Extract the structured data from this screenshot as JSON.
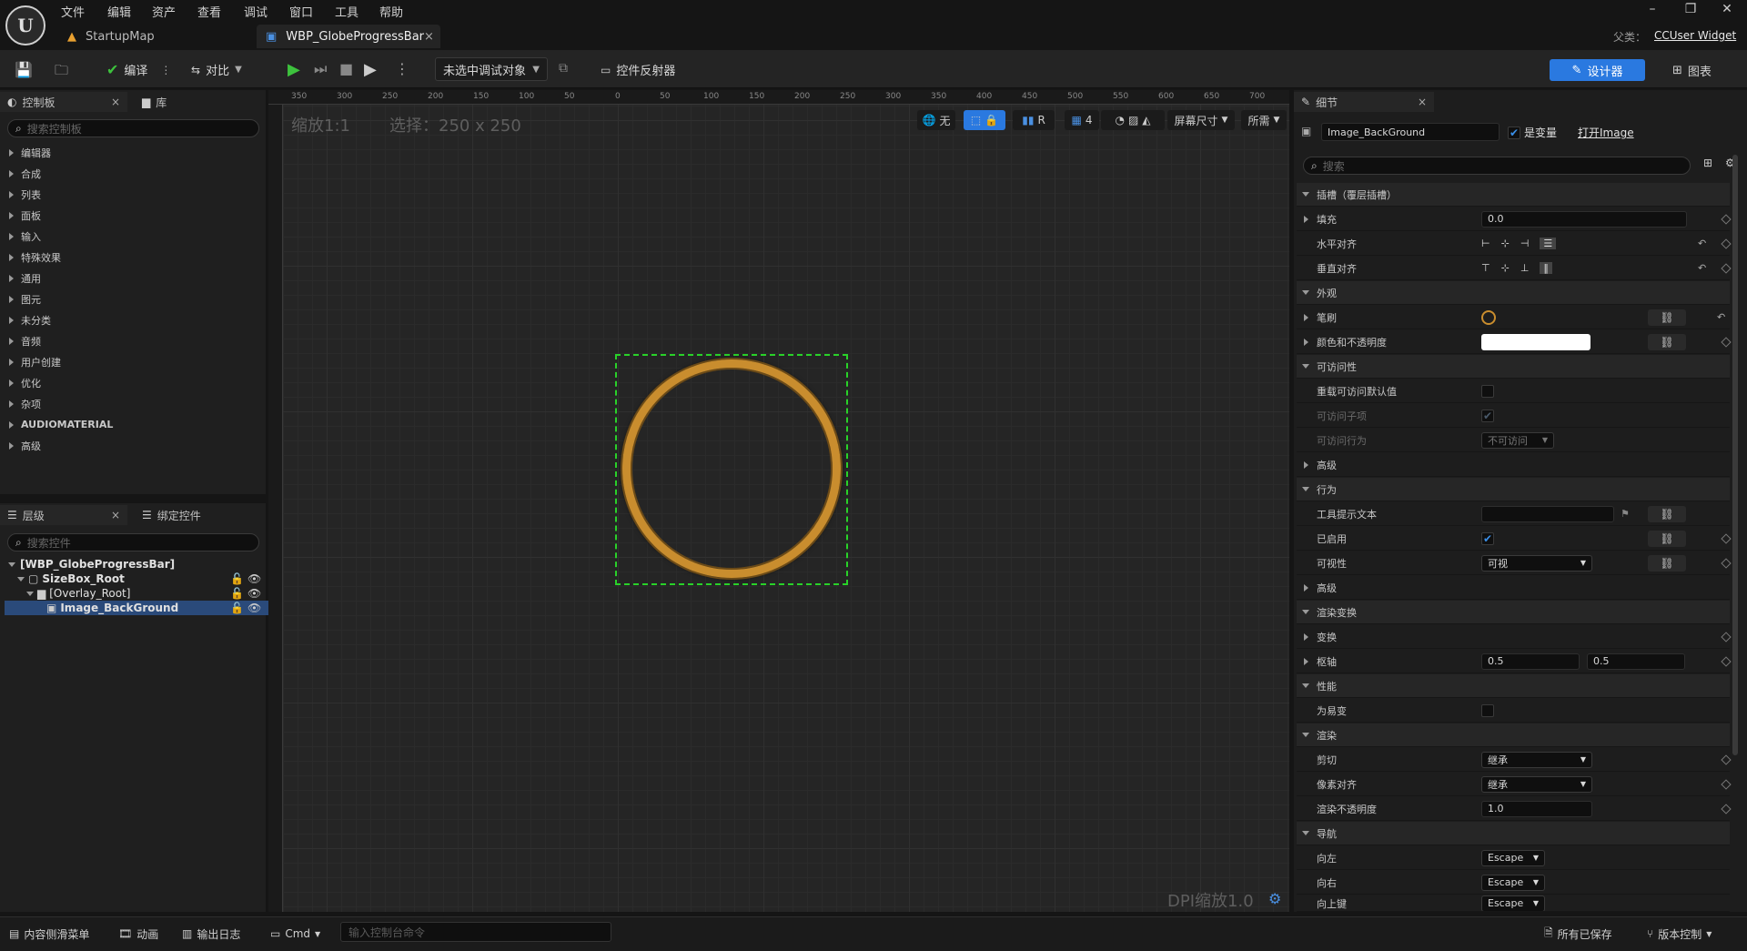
{
  "menu": [
    "文件",
    "编辑",
    "资产",
    "查看",
    "调试",
    "窗口",
    "工具",
    "帮助"
  ],
  "tabs": {
    "map": "StartupMap",
    "widget": "WBP_GlobeProgressBar"
  },
  "parent_class": {
    "label": "父类：",
    "value": "CCUser Widget"
  },
  "toolbar": {
    "compile": "编译",
    "diff": "对比",
    "debug_select": "未选中调试对象",
    "widget_reflector": "控件反射器",
    "designer": "设计器",
    "graph": "图表"
  },
  "palette": {
    "tab": "控制板",
    "library_tab": "库",
    "search_placeholder": "搜索控制板",
    "categories": [
      "编辑器",
      "合成",
      "列表",
      "面板",
      "输入",
      "特殊效果",
      "通用",
      "图元",
      "未分类",
      "音频",
      "用户创建",
      "优化",
      "杂项",
      "AUDIOMATERIAL",
      "高级"
    ]
  },
  "hierarchy": {
    "tab": "层级",
    "bind_tab": "绑定控件",
    "search_placeholder": "搜索控件",
    "items": [
      "[WBP_GlobeProgressBar]",
      "SizeBox_Root",
      "[Overlay_Root]",
      "Image_BackGround"
    ]
  },
  "canvas": {
    "zoom": "缩放1:1",
    "selection": "选择：250 x 250",
    "dpi": "DPI缩放1.0",
    "ruler_top": [
      "350",
      "300",
      "250",
      "200",
      "150",
      "100",
      "50",
      "0",
      "50",
      "100",
      "150",
      "200",
      "250",
      "300",
      "350",
      "400",
      "450",
      "500",
      "550",
      "600",
      "650",
      "700"
    ],
    "tools": {
      "none": "无",
      "r": "R",
      "grid": "4",
      "screen_size": "屏幕尺寸",
      "fill": "所需"
    }
  },
  "details": {
    "tab": "细节",
    "name": "Image_BackGround",
    "is_variable": "是变量",
    "open_image": "打开Image",
    "search_placeholder": "搜索",
    "rows": {
      "slot": "插槽（覆层插槽）",
      "padding": "填充",
      "padding_val": "0.0",
      "h_align": "水平对齐",
      "v_align": "垂直对齐",
      "appearance": "外观",
      "brush": "笔刷",
      "color_opacity": "颜色和不透明度",
      "accessibility": "可访问性",
      "override_access": "重载可访问默认值",
      "access_children": "可访问子项",
      "access_behavior": "可访问行为",
      "access_behavior_val": "不可访问",
      "advanced1": "高级",
      "behavior": "行为",
      "tooltip": "工具提示文本",
      "enabled": "已启用",
      "visibility": "可视性",
      "visibility_val": "可视",
      "advanced2": "高级",
      "render_transform": "渲染变换",
      "transform": "变换",
      "pivot": "枢轴",
      "pivot_x": "0.5",
      "pivot_y": "0.5",
      "performance": "性能",
      "volatile": "为易变",
      "rendering": "渲染",
      "clipping": "剪切",
      "clipping_val": "继承",
      "pixel_snap": "像素对齐",
      "pixel_snap_val": "继承",
      "render_opacity": "渲染不透明度",
      "render_opacity_val": "1.0",
      "navigation": "导航",
      "left": "向左",
      "left_val": "Escape",
      "right": "向右",
      "right_val": "Escape",
      "up": "向上键",
      "up_val": "Escape"
    }
  },
  "bottom": {
    "content_drawer": "内容侧滑菜单",
    "animation": "动画",
    "output_log": "输出日志",
    "cmd": "Cmd",
    "console_placeholder": "输入控制台命令",
    "all_saved": "所有已保存",
    "source_control": "版本控制"
  },
  "colors": {
    "accent": "#2a79e0",
    "selection": "#29d229",
    "ring": "#c98d2e"
  }
}
